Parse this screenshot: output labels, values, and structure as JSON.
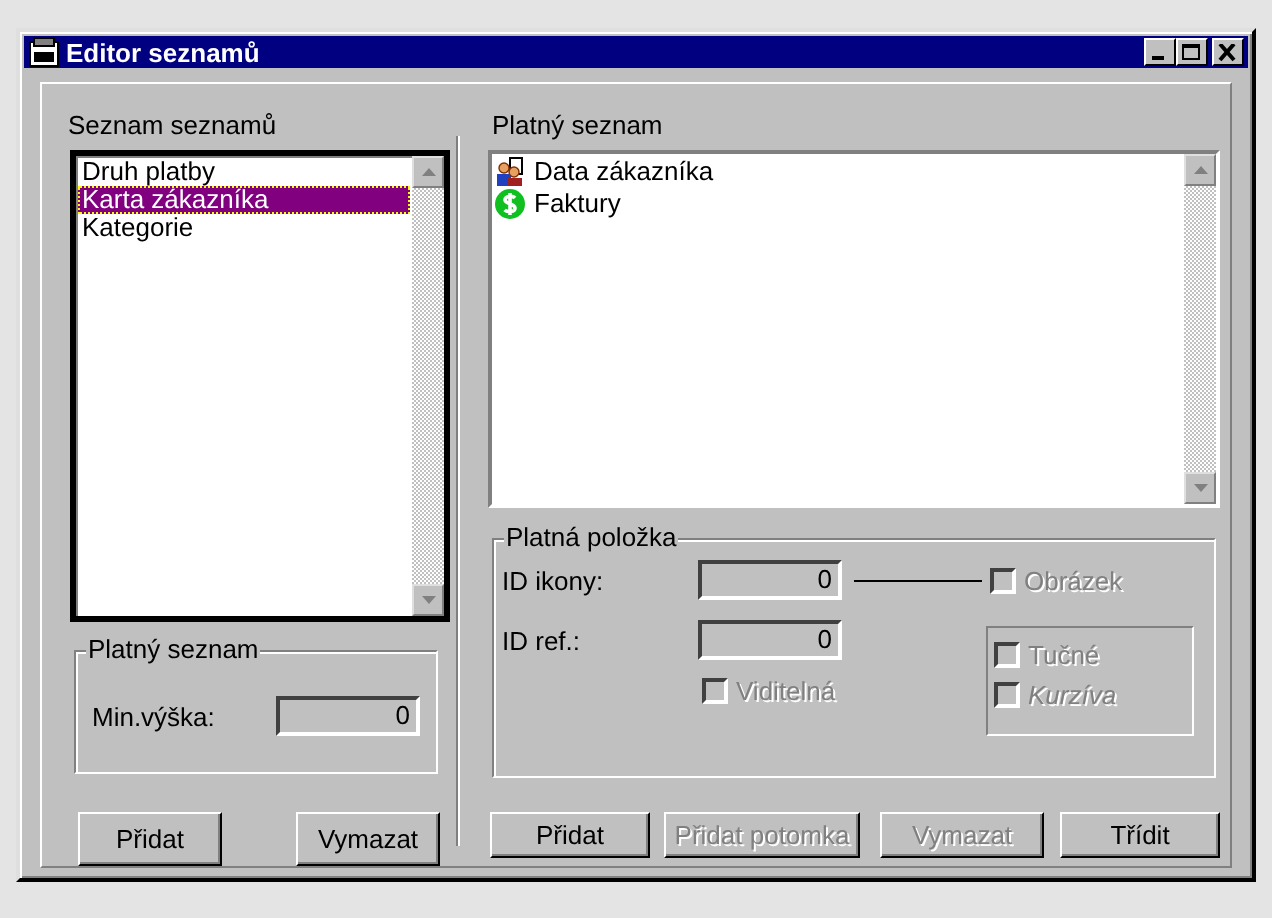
{
  "window": {
    "title": "Editor seznamů"
  },
  "lists_panel": {
    "label": "Seznam seznamů",
    "items": [
      {
        "text": "Druh platby",
        "selected": false
      },
      {
        "text": "Karta zákazníka",
        "selected": true
      },
      {
        "text": "Kategorie",
        "selected": false
      }
    ],
    "group": {
      "title": "Platný seznam",
      "field_label": "Min.výška:",
      "field_value": "0"
    },
    "buttons": [
      {
        "label": "Přidat",
        "disabled": false
      },
      {
        "label": "Vymazat",
        "disabled": false
      }
    ]
  },
  "current_list": {
    "label": "Platný seznam",
    "items": [
      {
        "text": "Data zákazníka",
        "kind": "people"
      },
      {
        "text": "Faktury",
        "kind": "money"
      }
    ]
  },
  "item_group": {
    "title": "Platná položka",
    "icon_id": {
      "label": "ID ikony:",
      "value": "0"
    },
    "ref_id": {
      "label": "ID ref.:",
      "value": "0"
    },
    "image_checkbox": {
      "label": "Obrázek",
      "checked": false,
      "disabled": true
    },
    "visible_checkbox": {
      "label": "Viditelná",
      "checked": false,
      "disabled": true
    },
    "format_checkboxes": [
      {
        "label": "Tučné",
        "checked": false,
        "disabled": true,
        "italic": false
      },
      {
        "label": "Kurzíva",
        "checked": false,
        "disabled": true,
        "italic": true
      }
    ]
  },
  "buttons": [
    {
      "label": "Přidat",
      "disabled": false
    },
    {
      "label": "Přidat potomka",
      "disabled": true
    },
    {
      "label": "Vymazat",
      "disabled": true
    },
    {
      "label": "Třídit",
      "disabled": false
    }
  ]
}
